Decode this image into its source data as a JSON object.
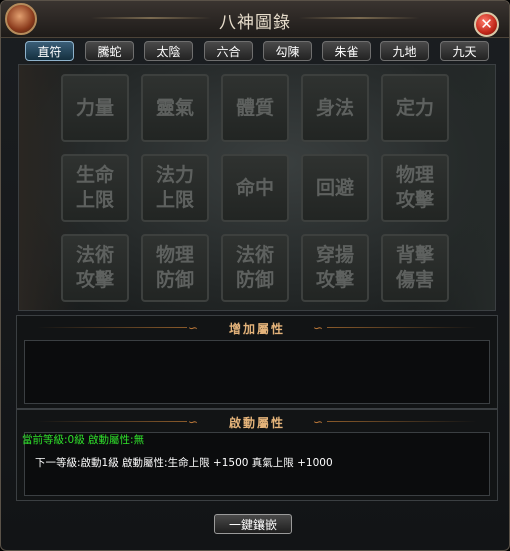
{
  "window": {
    "title": "八神圖錄",
    "close_label": "✕"
  },
  "tabs": [
    {
      "label": "直符",
      "active": true
    },
    {
      "label": "騰蛇",
      "active": false
    },
    {
      "label": "太陰",
      "active": false
    },
    {
      "label": "六合",
      "active": false
    },
    {
      "label": "勾陳",
      "active": false
    },
    {
      "label": "朱雀",
      "active": false
    },
    {
      "label": "九地",
      "active": false
    },
    {
      "label": "九天",
      "active": false
    }
  ],
  "slots": [
    "力量",
    "靈氣",
    "體質",
    "身法",
    "定力",
    "生命\n上限",
    "法力\n上限",
    "命中",
    "回避",
    "物理\n攻擊",
    "法術\n攻擊",
    "物理\n防御",
    "法術\n防御",
    "穿揚\n攻擊",
    "背擊\n傷害"
  ],
  "bonus_section": {
    "title": "增加屬性"
  },
  "activation_section": {
    "title": "啟動屬性",
    "current_line": "當前等級:0級  啟動屬性:無",
    "next_line": "下一等級:啟動1級  啟動屬性:生命上限  +1500  真氣上限  +1000"
  },
  "inlay_button": {
    "label": "一鍵鑲嵌"
  },
  "colors": {
    "accent_orange": "#e4b37a",
    "status_green": "#2fe02a",
    "active_tab": "#3a5e78"
  }
}
